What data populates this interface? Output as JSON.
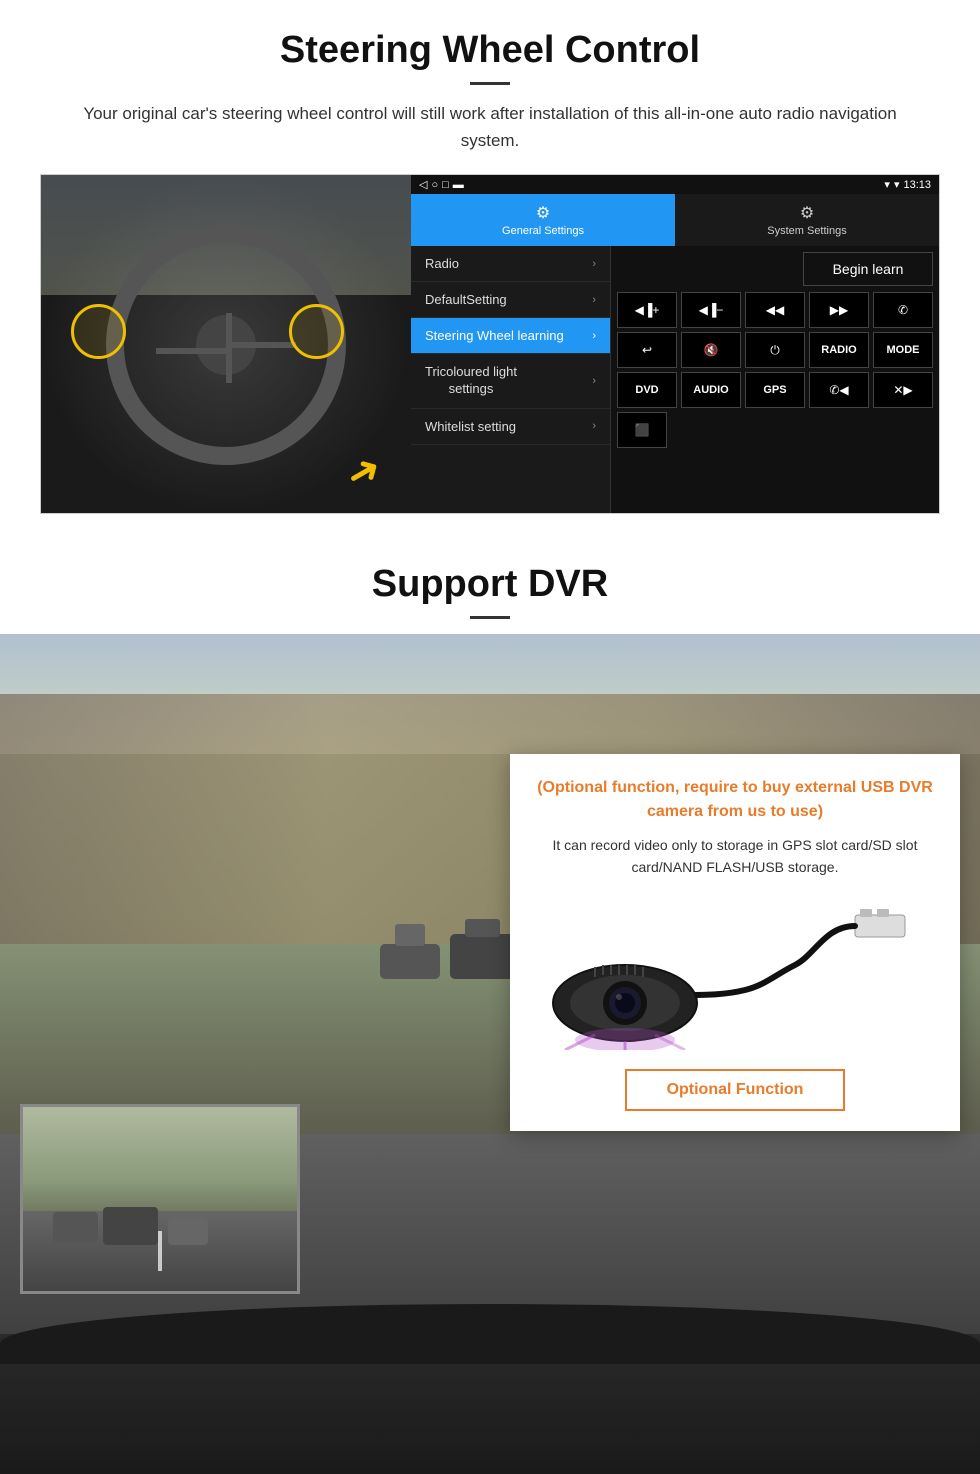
{
  "steering": {
    "title": "Steering Wheel Control",
    "subtitle": "Your original car's steering wheel control will still work after installation of this all-in-one auto radio navigation system.",
    "statusbar": {
      "signal": "▾",
      "wifi": "▾",
      "time": "13:13"
    },
    "tabs": {
      "general": "General Settings",
      "system": "System Settings"
    },
    "menu": {
      "items": [
        {
          "label": "Radio",
          "active": false
        },
        {
          "label": "DefaultSetting",
          "active": false
        },
        {
          "label": "Steering Wheel learning",
          "active": true
        },
        {
          "label": "Tricoloured light settings",
          "active": false
        },
        {
          "label": "Whitelist setting",
          "active": false
        }
      ]
    },
    "begin_learn": "Begin learn",
    "controls": {
      "row1": [
        "▐▐+",
        "▐▐−",
        "◀◀",
        "▶▶",
        "✆"
      ],
      "row2": [
        "↩",
        "◁×",
        "⏻",
        "RADIO",
        "MODE"
      ],
      "row3": [
        "DVD",
        "AUDIO",
        "GPS",
        "✆◀◀",
        "✕▶▶"
      ],
      "row4": [
        "⬛"
      ]
    }
  },
  "dvr": {
    "title": "Support DVR",
    "optional_text": "(Optional function, require to buy external USB DVR camera from us to use)",
    "body_text": "It can record video only to storage in GPS slot card/SD slot card/NAND FLASH/USB storage.",
    "optional_btn": "Optional Function"
  }
}
